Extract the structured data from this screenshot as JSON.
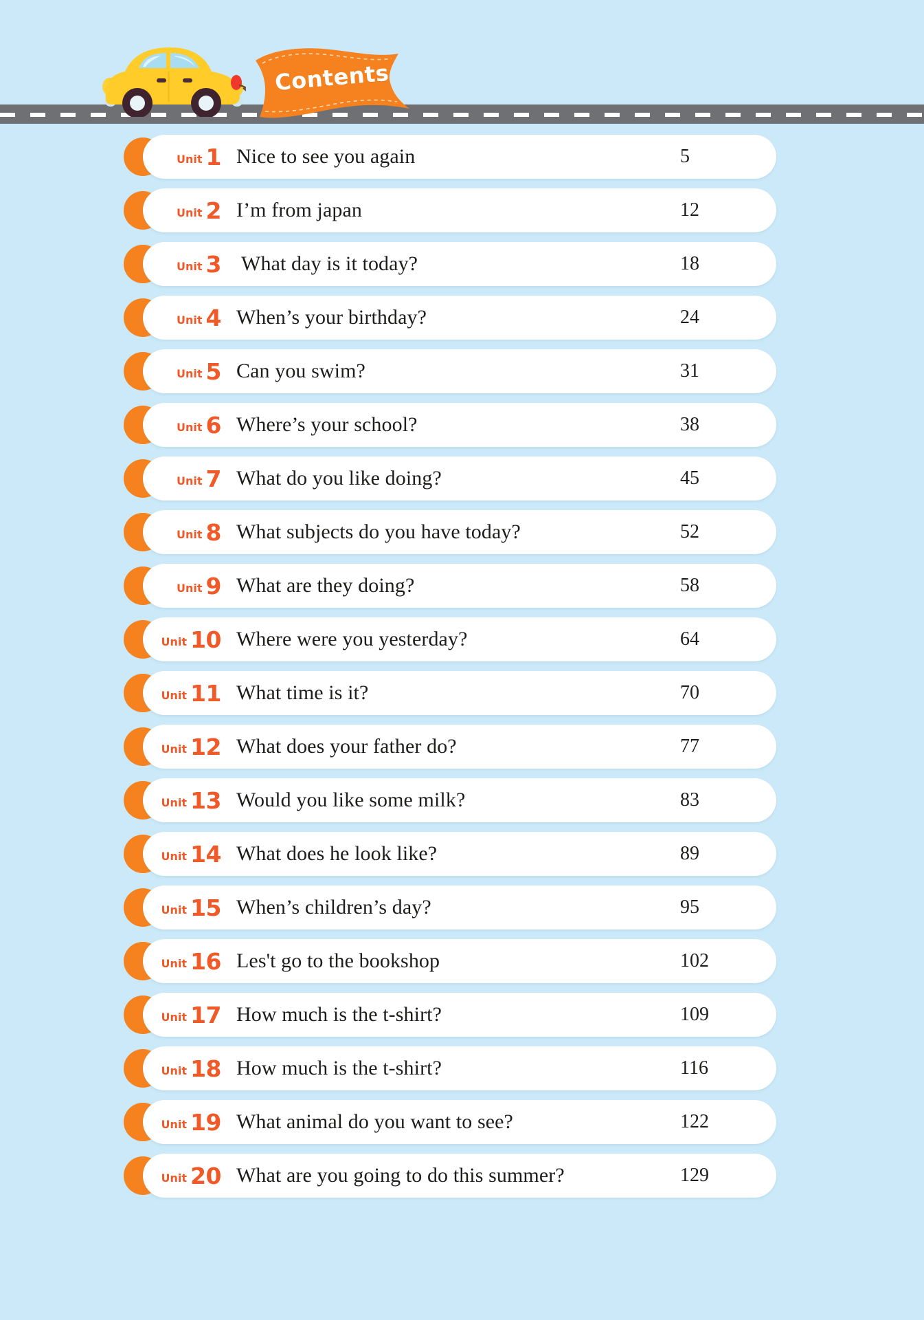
{
  "page": {
    "background_color": "#cbe9f8",
    "accent_color": "#f5821f",
    "accent_dark_color": "#f05a28",
    "text_color": "#1d1d1b",
    "road_color": "#6f7073"
  },
  "header": {
    "banner_label": "Contents",
    "car_icon": "yellow-car-icon",
    "road_icon": "road-with-dashes"
  },
  "contents": {
    "unit_word": "Unit",
    "rows": [
      {
        "unit": "1",
        "title": "Nice to see you again",
        "page": "5"
      },
      {
        "unit": "2",
        "title": "I’m from japan",
        "page": "12"
      },
      {
        "unit": "3",
        "title": " What day is it today?",
        "page": "18"
      },
      {
        "unit": "4",
        "title": "When’s your birthday?",
        "page": "24"
      },
      {
        "unit": "5",
        "title": "Can you swim?",
        "page": "31"
      },
      {
        "unit": "6",
        "title": "Where’s your school?",
        "page": "38"
      },
      {
        "unit": "7",
        "title": "What do you like doing?",
        "page": "45"
      },
      {
        "unit": "8",
        "title": "What subjects do you have today?",
        "page": "52"
      },
      {
        "unit": "9",
        "title": "What are they doing?",
        "page": "58"
      },
      {
        "unit": "10",
        "title": "Where were you yesterday?",
        "page": "64"
      },
      {
        "unit": "11",
        "title": "What time is it?",
        "page": "70"
      },
      {
        "unit": "12",
        "title": "What does your father do?",
        "page": "77"
      },
      {
        "unit": "13",
        "title": "Would you like some milk?",
        "page": "83"
      },
      {
        "unit": "14",
        "title": "What does he look like?",
        "page": "89"
      },
      {
        "unit": "15",
        "title": "When’s children’s day?",
        "page": "95"
      },
      {
        "unit": "16",
        "title": "Les't go to the bookshop",
        "page": "102"
      },
      {
        "unit": "17",
        "title": "How much is the t-shirt?",
        "page": "109"
      },
      {
        "unit": "18",
        "title": "How much is the t-shirt?",
        "page": "116"
      },
      {
        "unit": "19",
        "title": "What animal do you want to see?",
        "page": "122"
      },
      {
        "unit": "20",
        "title": "What are you going to do this summer?",
        "page": "129"
      }
    ]
  }
}
